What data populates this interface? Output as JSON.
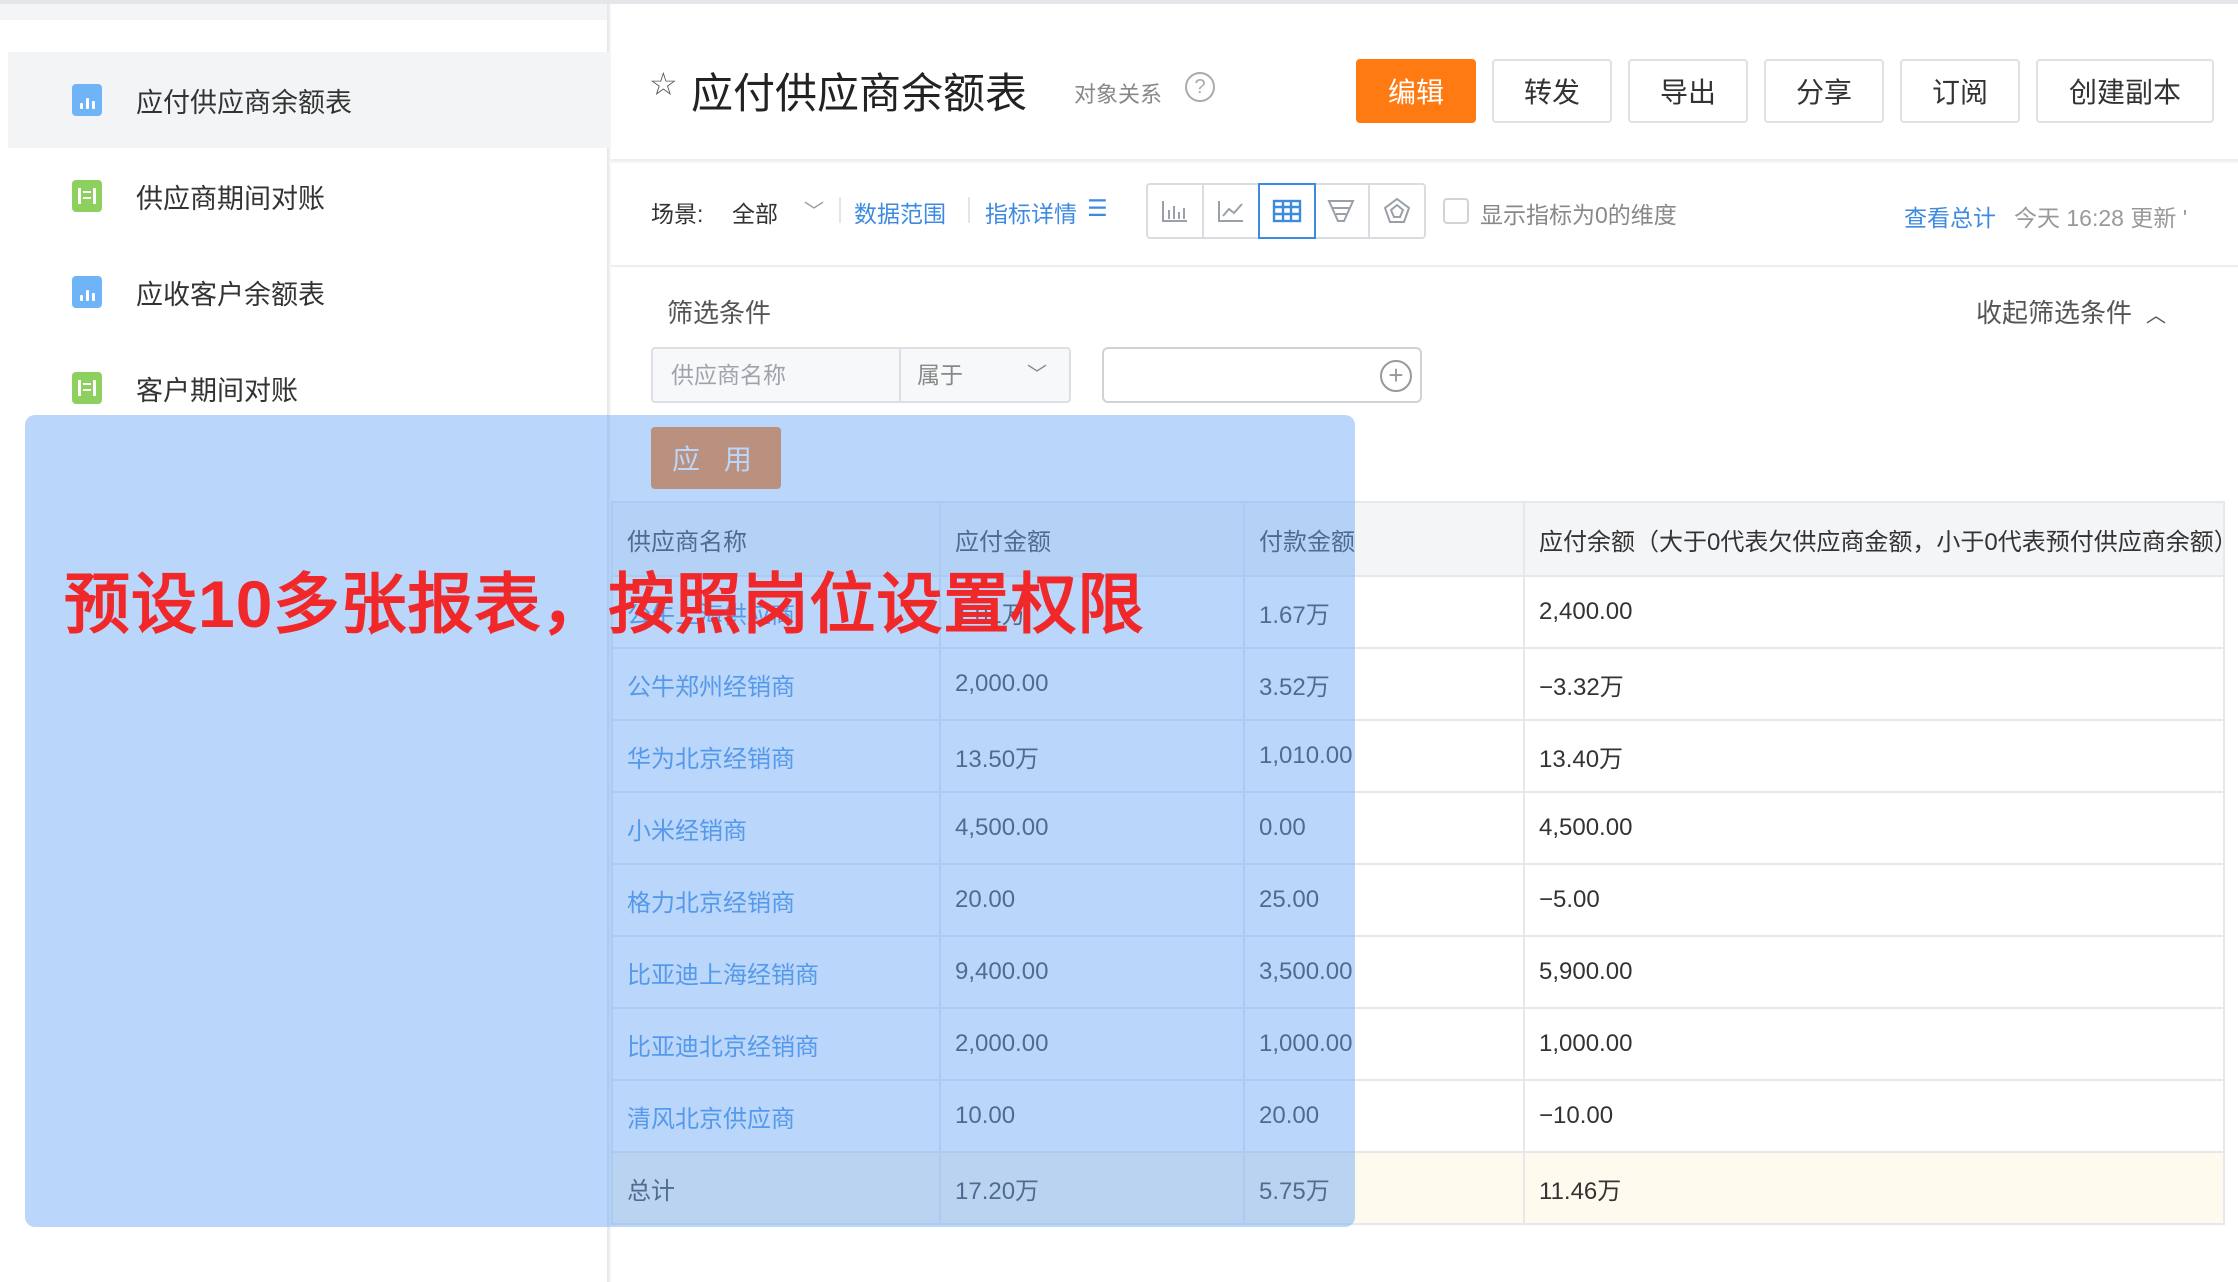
{
  "sidebar": {
    "items": [
      {
        "label": "应付供应商余额表",
        "icon": "bar-chart-report-icon",
        "active": true
      },
      {
        "label": "供应商期间对账",
        "icon": "table-report-icon",
        "active": false
      },
      {
        "label": "应收客户余额表",
        "icon": "bar-chart-report-icon",
        "active": false
      },
      {
        "label": "客户期间对账",
        "icon": "table-report-icon",
        "active": false
      }
    ]
  },
  "header": {
    "title": "应付供应商余额表",
    "relation_label": "对象关系",
    "help_icon": "?",
    "buttons": [
      "编辑",
      "转发",
      "导出",
      "分享",
      "订阅",
      "创建副本"
    ]
  },
  "toolbar": {
    "scene_label": "场景:",
    "scene_value": "全部",
    "data_range": "数据范围",
    "indicator_detail": "指标详情",
    "chart_types": [
      "bar-chart-icon",
      "line-chart-icon",
      "table-icon",
      "funnel-icon",
      "radar-icon"
    ],
    "active_chart": "table-icon",
    "show_zero_label": "显示指标为0的维度",
    "view_total": "查看总计",
    "updated": "今天 16:28 更新 '"
  },
  "filter": {
    "title": "筛选条件",
    "collapse_label": "收起筛选条件",
    "field_placeholder": "供应商名称",
    "operator": "属于",
    "apply_label": "应 用"
  },
  "table": {
    "headers": [
      "供应商名称",
      "应付金额",
      "付款金额",
      "应付余额（大于0代表欠供应商金额，小于0代表预付供应商余额）"
    ],
    "rows": [
      [
        "公牛上海供应商",
        "1.01万",
        "1.67万",
        "2,400.00"
      ],
      [
        "公牛郑州经销商",
        "2,000.00",
        "3.52万",
        "−3.32万"
      ],
      [
        "华为北京经销商",
        "13.50万",
        "1,010.00",
        "13.40万"
      ],
      [
        "小米经销商",
        "4,500.00",
        "0.00",
        "4,500.00"
      ],
      [
        "格力北京经销商",
        "20.00",
        "25.00",
        "−5.00"
      ],
      [
        "比亚迪上海经销商",
        "9,400.00",
        "3,500.00",
        "5,900.00"
      ],
      [
        "比亚迪北京经销商",
        "2,000.00",
        "1,000.00",
        "1,000.00"
      ],
      [
        "清风北京供应商",
        "10.00",
        "20.00",
        "−10.00"
      ]
    ],
    "total": [
      "总计",
      "17.20万",
      "5.75万",
      "11.46万"
    ]
  },
  "overlay": {
    "caption": "预设10多张报表，按照岗位设置权限"
  },
  "colors": {
    "primary_orange": "#ff7a12",
    "link_blue": "#3c8be0",
    "caption_red": "#f0282a"
  }
}
